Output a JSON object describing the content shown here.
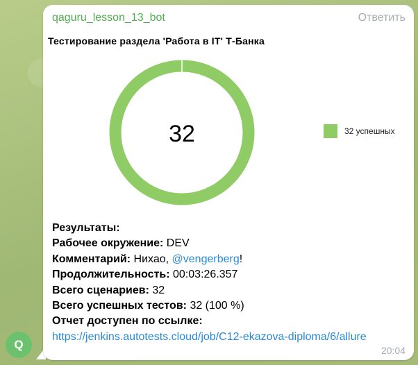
{
  "avatar": {
    "letter": "Q",
    "color": "#6cc16f"
  },
  "message": {
    "sender": "qaguru_lesson_13_bot",
    "reply_label": "Ответить",
    "time": "20:04",
    "chart_data": {
      "type": "pie",
      "donut": true,
      "title": "Тестирование раздела 'Работа в IT' Т-Банка",
      "center_label": "32",
      "slices": [
        {
          "label": "32 успешных",
          "value": 32,
          "color": "#8fcc65"
        }
      ],
      "legend_position": "right"
    },
    "results": {
      "heading": "Результаты:",
      "env_label": "Рабочее окружение:",
      "env_value": "DEV",
      "comment_label": "Комментарий:",
      "comment_text": "Нихао, ",
      "comment_mention": "@vengerberg",
      "comment_suffix": "!",
      "duration_label": "Продолжительность:",
      "duration_value": "00:03:26.357",
      "scenarios_label": "Всего сценариев:",
      "scenarios_value": "32",
      "passed_label": "Всего успешных тестов:",
      "passed_value": "32 (100 %)",
      "report_label": "Отчет доступен по ссылке:",
      "report_link": "https://jenkins.autotests.cloud/job/C12-ekazova-diploma/6/allure"
    }
  }
}
